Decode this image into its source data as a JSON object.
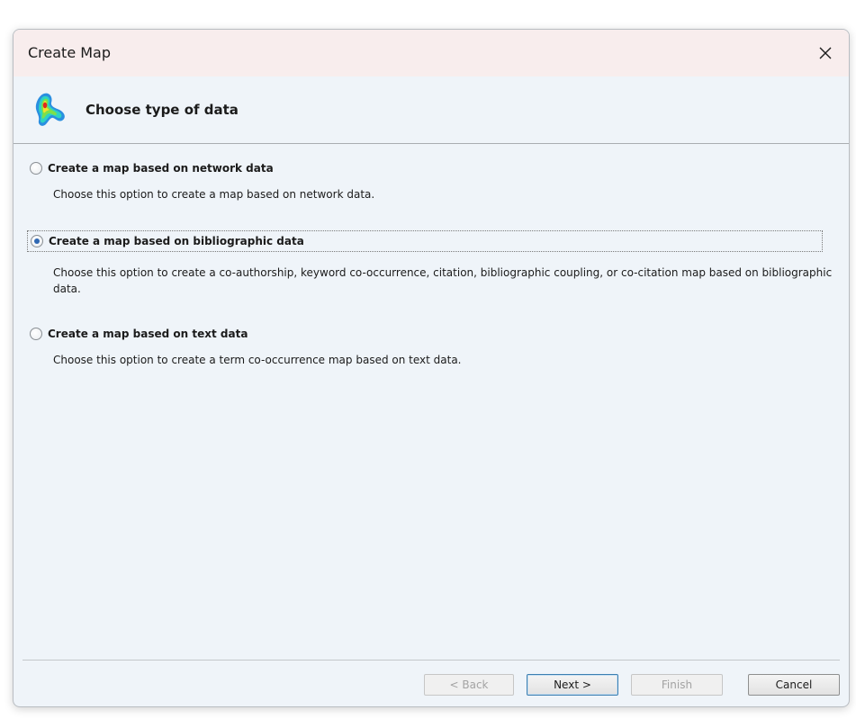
{
  "window": {
    "title": "Create Map",
    "close_icon": "close-icon"
  },
  "header": {
    "heading": "Choose type of data",
    "logo_icon": "vosviewer-density-logo-icon"
  },
  "options": [
    {
      "label": "Create a map based on network data",
      "description": "Choose this option to create a map based on network data.",
      "selected": false
    },
    {
      "label": "Create a map based on bibliographic data",
      "description": "Choose this option to create a co-authorship, keyword co-occurrence, citation, bibliographic coupling, or co-citation map based on bibliographic data.",
      "selected": true
    },
    {
      "label": "Create a map based on text data",
      "description": "Choose this option to create a term co-occurrence map based on text data.",
      "selected": false
    }
  ],
  "buttons": {
    "back": "< Back",
    "next": "Next >",
    "finish": "Finish",
    "cancel": "Cancel"
  },
  "colors": {
    "titlebar_bg": "#f8eded",
    "dialog_bg": "#eff4f9",
    "radio_selected": "#2f68b3",
    "default_button_border": "#3c7fb1"
  }
}
